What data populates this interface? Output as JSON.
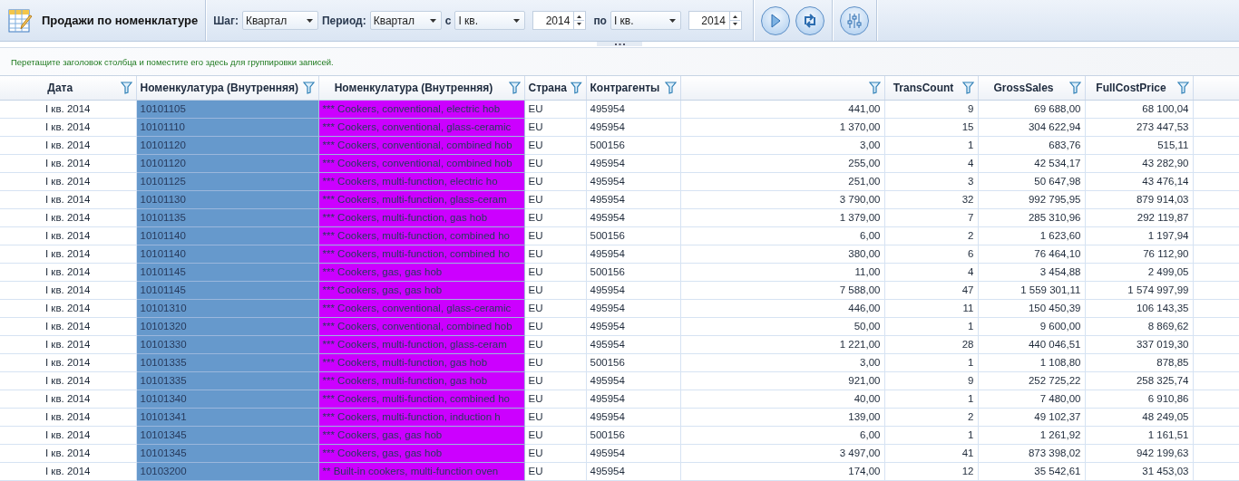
{
  "toolbar": {
    "title": "Продажи по номенклатуре",
    "fields": [
      {
        "kind": "combo",
        "label": "Шаг:",
        "value": "Квартал"
      },
      {
        "kind": "combo",
        "label": "Период:",
        "value": "Квартал"
      },
      {
        "kind": "combo",
        "label": "с",
        "value": "I кв."
      },
      {
        "kind": "spin",
        "value": "2014"
      },
      {
        "kind": "combo",
        "label": "по",
        "value": "I кв."
      },
      {
        "kind": "spin",
        "value": "2014"
      }
    ]
  },
  "group_panel": {
    "hint": "Перетащите заголовок столбца и поместите его здесь для группировки записей."
  },
  "table": {
    "columns": [
      {
        "title": "Дата",
        "kind": "date"
      },
      {
        "title": "Номенкулатура (Внутренняя)",
        "kind": "code",
        "color": "#6699cc"
      },
      {
        "title": "Номенкулатура (Внутренняя)",
        "kind": "text",
        "color": "#cc00ff"
      },
      {
        "title": "Страна",
        "kind": "short"
      },
      {
        "title": "Контрагенты",
        "kind": "short"
      },
      {
        "kind": "number"
      },
      {
        "title": "TransCount",
        "kind": "number"
      },
      {
        "title": "GrossSales",
        "kind": "number"
      },
      {
        "title": "FullCostPrice",
        "kind": "number"
      }
    ],
    "rows": [
      [
        "I кв. 2014",
        "10101105",
        "*** Cookers, conventional, electric hob",
        "EU",
        "495954",
        "441,00",
        "9",
        "69 688,00",
        "68 100,04"
      ],
      [
        "I кв. 2014",
        "10101110",
        "*** Cookers, conventional, glass-ceramic",
        "EU",
        "495954",
        "1 370,00",
        "15",
        "304 622,94",
        "273 447,53"
      ],
      [
        "I кв. 2014",
        "10101120",
        "*** Cookers, conventional, combined hob",
        "EU",
        "500156",
        "3,00",
        "1",
        "683,76",
        "515,11"
      ],
      [
        "I кв. 2014",
        "10101120",
        "*** Cookers, conventional, combined hob",
        "EU",
        "495954",
        "255,00",
        "4",
        "42 534,17",
        "43 282,90"
      ],
      [
        "I кв. 2014",
        "10101125",
        "*** Cookers, multi-function, electric ho",
        "EU",
        "495954",
        "251,00",
        "3",
        "50 647,98",
        "43 476,14"
      ],
      [
        "I кв. 2014",
        "10101130",
        "*** Cookers, multi-function, glass-ceram",
        "EU",
        "495954",
        "3 790,00",
        "32",
        "992 795,95",
        "879 914,03"
      ],
      [
        "I кв. 2014",
        "10101135",
        "*** Cookers, multi-function, gas hob",
        "EU",
        "495954",
        "1 379,00",
        "7",
        "285 310,96",
        "292 119,87"
      ],
      [
        "I кв. 2014",
        "10101140",
        "*** Cookers, multi-function, combined ho",
        "EU",
        "500156",
        "6,00",
        "2",
        "1 623,60",
        "1 197,94"
      ],
      [
        "I кв. 2014",
        "10101140",
        "*** Cookers, multi-function, combined ho",
        "EU",
        "495954",
        "380,00",
        "6",
        "76 464,10",
        "76 112,90"
      ],
      [
        "I кв. 2014",
        "10101145",
        "*** Cookers, gas, gas hob",
        "EU",
        "500156",
        "11,00",
        "4",
        "3 454,88",
        "2 499,05"
      ],
      [
        "I кв. 2014",
        "10101145",
        "*** Cookers, gas, gas hob",
        "EU",
        "495954",
        "7 588,00",
        "47",
        "1 559 301,11",
        "1 574 997,99"
      ],
      [
        "I кв. 2014",
        "10101310",
        "*** Cookers, conventional, glass-ceramic",
        "EU",
        "495954",
        "446,00",
        "11",
        "150 450,39",
        "106 143,35"
      ],
      [
        "I кв. 2014",
        "10101320",
        "*** Cookers, conventional, combined hob",
        "EU",
        "495954",
        "50,00",
        "1",
        "9 600,00",
        "8 869,62"
      ],
      [
        "I кв. 2014",
        "10101330",
        "*** Cookers, multi-function, glass-ceram",
        "EU",
        "495954",
        "1 221,00",
        "28",
        "440 046,51",
        "337 019,30"
      ],
      [
        "I кв. 2014",
        "10101335",
        "*** Cookers, multi-function, gas hob",
        "EU",
        "500156",
        "3,00",
        "1",
        "1 108,80",
        "878,85"
      ],
      [
        "I кв. 2014",
        "10101335",
        "*** Cookers, multi-function, gas hob",
        "EU",
        "495954",
        "921,00",
        "9",
        "252 725,22",
        "258 325,74"
      ],
      [
        "I кв. 2014",
        "10101340",
        "*** Cookers, multi-function, combined ho",
        "EU",
        "495954",
        "40,00",
        "1",
        "7 480,00",
        "6 910,86"
      ],
      [
        "I кв. 2014",
        "10101341",
        "*** Cookers, multi-function, induction h",
        "EU",
        "495954",
        "139,00",
        "2",
        "49 102,37",
        "48 249,05"
      ],
      [
        "I кв. 2014",
        "10101345",
        "*** Cookers, gas, gas hob",
        "EU",
        "500156",
        "6,00",
        "1",
        "1 261,92",
        "1 161,51"
      ],
      [
        "I кв. 2014",
        "10101345",
        "*** Cookers, gas, gas hob",
        "EU",
        "495954",
        "3 497,00",
        "41",
        "873 398,02",
        "942 199,63"
      ],
      [
        "I кв. 2014",
        "10103200",
        "** Built-in cookers, multi-function oven",
        "EU",
        "495954",
        "174,00",
        "12",
        "35 542,61",
        "31 453,03"
      ]
    ]
  }
}
